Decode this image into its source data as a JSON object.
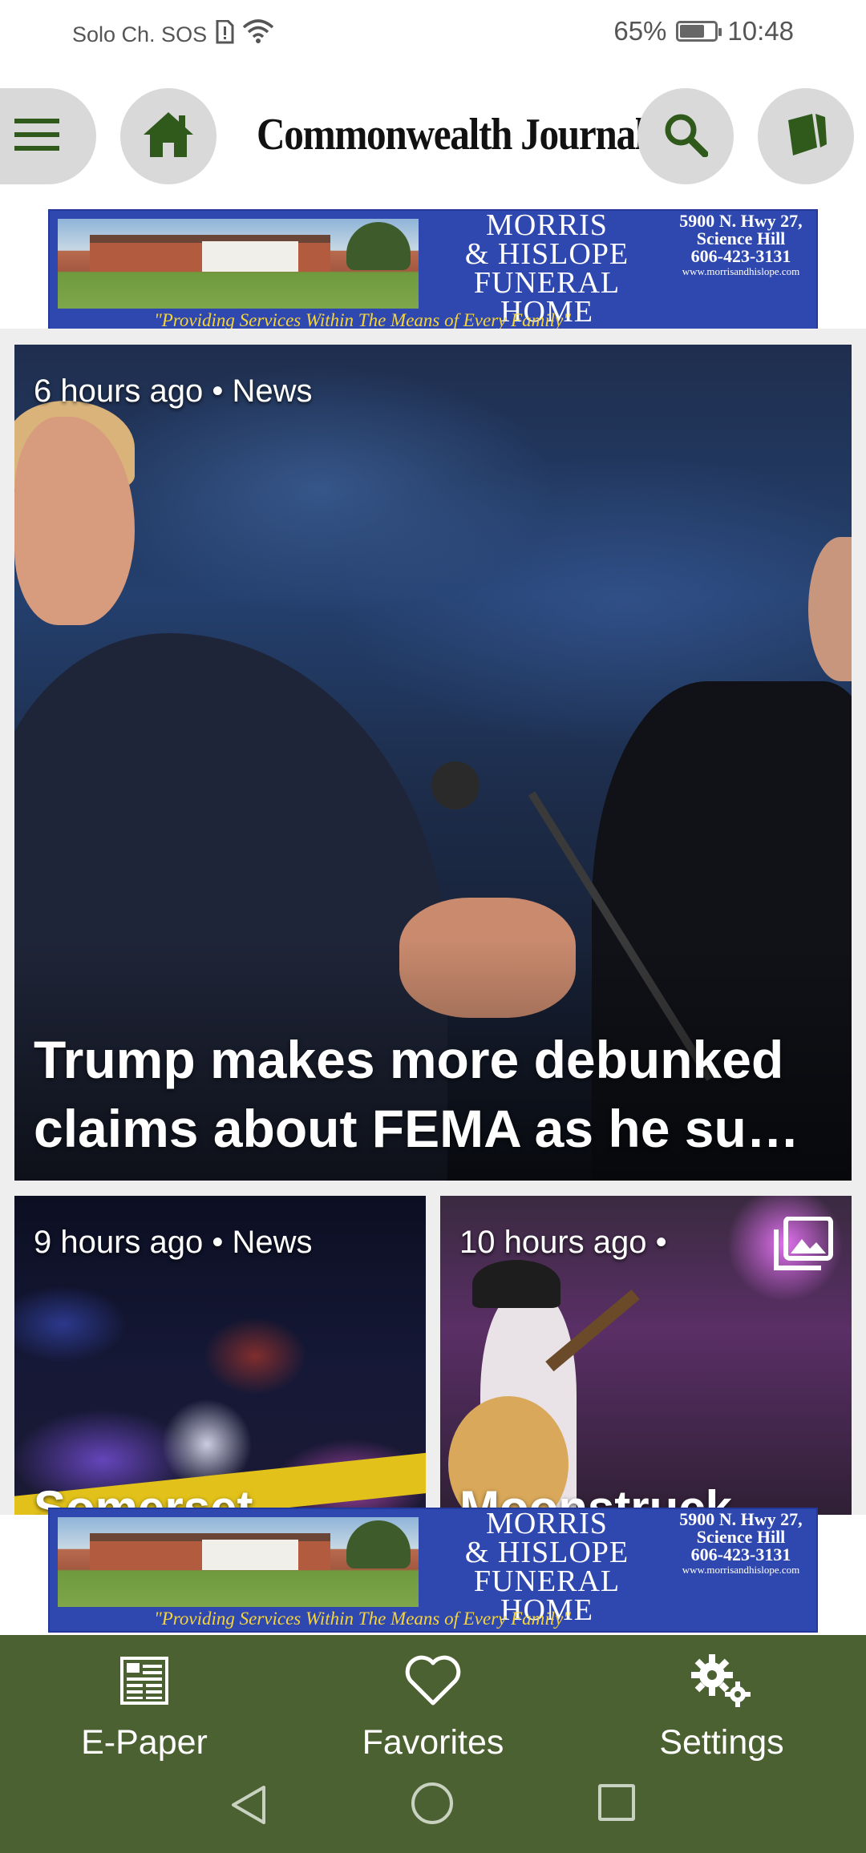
{
  "status_bar": {
    "carrier": "Solo Ch. SOS",
    "battery_percent": "65%",
    "battery_level": 0.65,
    "time": "10:48",
    "icons": [
      "sim-alert-icon",
      "wifi-icon",
      "battery-icon"
    ]
  },
  "header": {
    "logo": "Commonwealth Journal",
    "buttons": [
      "menu-icon",
      "home-icon",
      "search-icon",
      "e-paper-icon"
    ],
    "accent_color": "#2f5a1c"
  },
  "ad": {
    "name_line1": "MORRIS",
    "name_line2": "& HISLOPE",
    "name_line3": "FUNERAL HOME",
    "address_line1": "5900 N. Hwy 27,",
    "address_line2": "Science Hill",
    "phone": "606-423-3131",
    "website": "www.morrisandhislope.com",
    "tagline": "\"Providing Services Within The Means of Every Family\""
  },
  "feed": {
    "articles": [
      {
        "meta": "6 hours ago • News",
        "title": "Trump makes more debunked claims about FEMA as he su…"
      },
      {
        "meta": "9 hours ago • News",
        "title": "Somerset"
      },
      {
        "meta": "10 hours ago •",
        "title": "Moonstruck",
        "gallery_icon": "gallery-icon"
      }
    ]
  },
  "bottom_nav": {
    "background": "#4b6131",
    "items": [
      {
        "label": "E-Paper",
        "icon": "newspaper-icon"
      },
      {
        "label": "Favorites",
        "icon": "heart-icon"
      },
      {
        "label": "Settings",
        "icon": "gear-icon"
      }
    ]
  },
  "system_nav": {
    "buttons": [
      "back-icon",
      "home-circle-icon",
      "recents-icon"
    ]
  }
}
